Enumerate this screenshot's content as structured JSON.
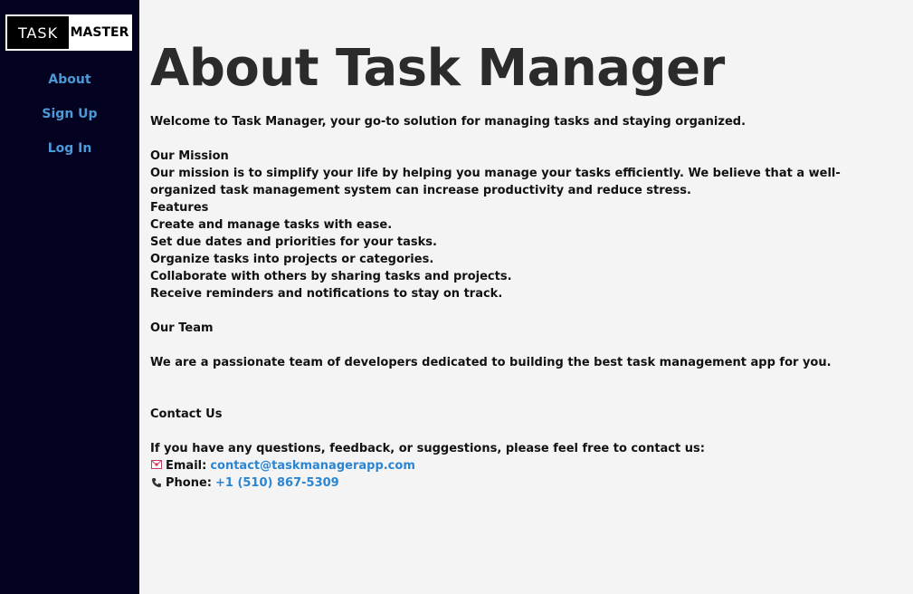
{
  "sidebar": {
    "logo": {
      "left_text": "TASK",
      "right_text": "MASTER"
    },
    "nav": [
      {
        "label": "About"
      },
      {
        "label": "Sign Up"
      },
      {
        "label": "Log In"
      }
    ]
  },
  "main": {
    "title": "About Task Manager",
    "intro": "Welcome to Task Manager, your go-to solution for managing tasks and staying organized.",
    "mission_heading": "Our Mission",
    "mission_text": "Our mission is to simplify your life by helping you manage your tasks efficiently. We believe that a well-organized task management system can increase productivity and reduce stress.",
    "features_heading": "Features",
    "features": [
      "Create and manage tasks with ease.",
      "Set due dates and priorities for your tasks.",
      "Organize tasks into projects or categories.",
      "Collaborate with others by sharing tasks and projects.",
      "Receive reminders and notifications to stay on track."
    ],
    "team_heading": "Our Team",
    "team_text": "We are a passionate team of developers dedicated to building the best task management app for you.",
    "contact_heading": "Contact Us",
    "contact_text": "If you have any questions, feedback, or suggestions, please feel free to contact us:",
    "email_label": "Email:",
    "email_icon": "envelope-icon",
    "email_value": "contact@taskmanagerapp.com",
    "phone_label": "Phone:",
    "phone_icon": "phone-icon",
    "phone_value": "+1 (510) 867-5309"
  },
  "colors": {
    "sidebar_bg": "#030321",
    "nav_link": "#4a9ad8",
    "content_link": "#2a86d4",
    "page_bg": "#f4f4f4"
  }
}
